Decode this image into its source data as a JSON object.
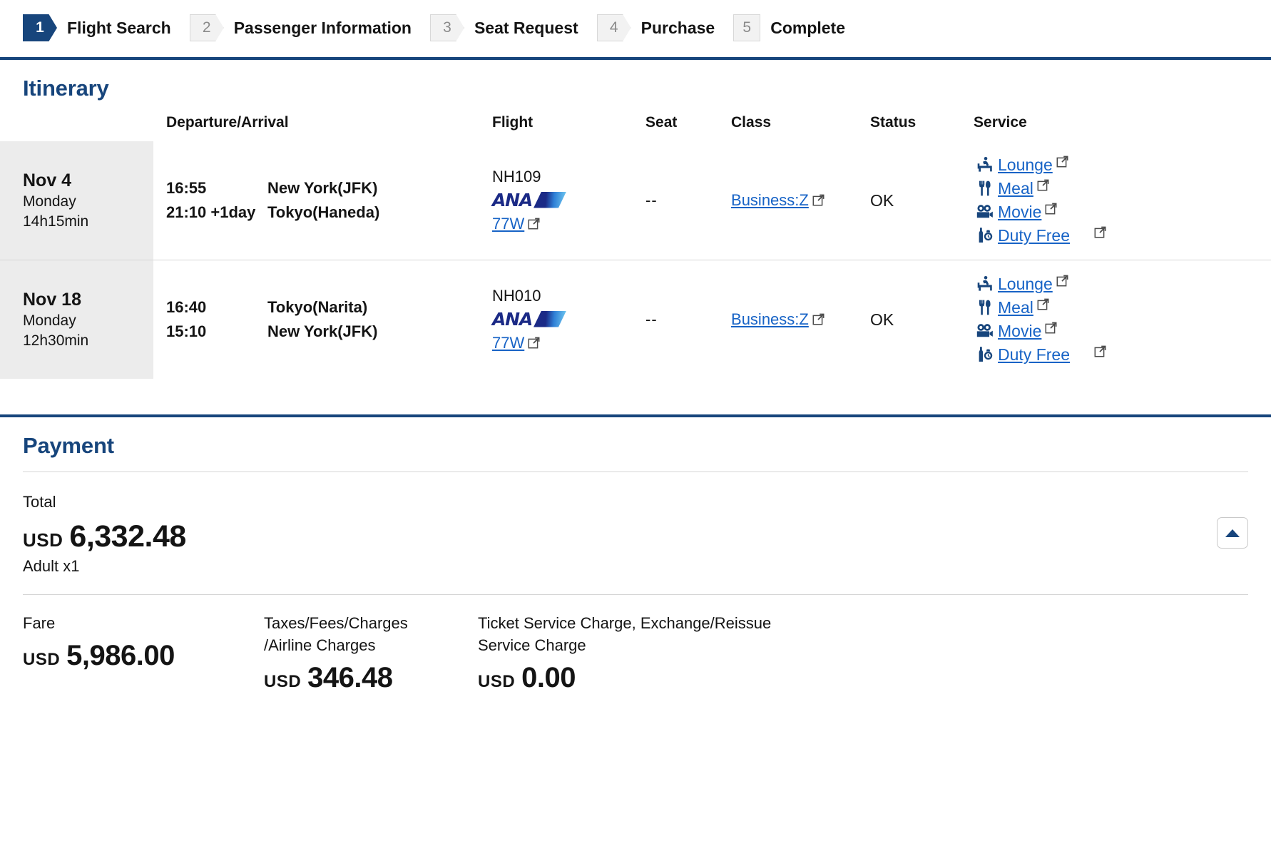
{
  "steps": [
    {
      "num": "1",
      "label": "Flight Search",
      "state": "active"
    },
    {
      "num": "2",
      "label": "Passenger Information",
      "state": "idle"
    },
    {
      "num": "3",
      "label": "Seat Request",
      "state": "idle"
    },
    {
      "num": "4",
      "label": "Purchase",
      "state": "idle"
    },
    {
      "num": "5",
      "label": "Complete",
      "state": "idle-flat"
    }
  ],
  "itinerary": {
    "title": "Itinerary",
    "columns": {
      "departure_arrival": "Departure/Arrival",
      "flight": "Flight",
      "seat": "Seat",
      "class": "Class",
      "status": "Status",
      "service": "Service"
    },
    "rows": [
      {
        "date": "Nov 4",
        "weekday": "Monday",
        "duration": "14h15min",
        "depart_time": "16:55",
        "depart_place": "New York(JFK)",
        "arrive_time": "21:10 +1day",
        "arrive_place": "Tokyo(Haneda)",
        "flight_no": "NH109",
        "airline_logo": "ANA",
        "aircraft": "77W",
        "seat": "--",
        "class": "Business:Z",
        "status": "OK",
        "services": [
          {
            "icon": "lounge-chair-icon",
            "label": "Lounge"
          },
          {
            "icon": "cutlery-icon",
            "label": "Meal"
          },
          {
            "icon": "movie-camera-icon",
            "label": "Movie"
          },
          {
            "icon": "duty-free-icon",
            "label": "Duty Free"
          }
        ]
      },
      {
        "date": "Nov 18",
        "weekday": "Monday",
        "duration": "12h30min",
        "depart_time": "16:40",
        "depart_place": "Tokyo(Narita)",
        "arrive_time": "15:10",
        "arrive_place": "New York(JFK)",
        "flight_no": "NH010",
        "airline_logo": "ANA",
        "aircraft": "77W",
        "seat": "--",
        "class": "Business:Z",
        "status": "OK",
        "services": [
          {
            "icon": "lounge-chair-icon",
            "label": "Lounge"
          },
          {
            "icon": "cutlery-icon",
            "label": "Meal"
          },
          {
            "icon": "movie-camera-icon",
            "label": "Movie"
          },
          {
            "icon": "duty-free-icon",
            "label": "Duty Free"
          }
        ]
      }
    ]
  },
  "payment": {
    "title": "Payment",
    "total_label": "Total",
    "total_currency": "USD",
    "total_amount": "6,332.48",
    "passengers": "Adult x1",
    "collapse_icon": "triangle-up-icon",
    "breakdown": [
      {
        "label": "Fare",
        "currency": "USD",
        "amount": "5,986.00"
      },
      {
        "label": "Taxes/Fees/Charges\n/Airline Charges",
        "currency": "USD",
        "amount": "346.48"
      },
      {
        "label": "Ticket Service Charge, Exchange/Reissue Service Charge",
        "currency": "USD",
        "amount": "0.00"
      }
    ]
  },
  "colors": {
    "brand_navy": "#17457c",
    "link_blue": "#1763c6",
    "ana_navy": "#1b2a86",
    "row_date_bg": "#ececec"
  }
}
